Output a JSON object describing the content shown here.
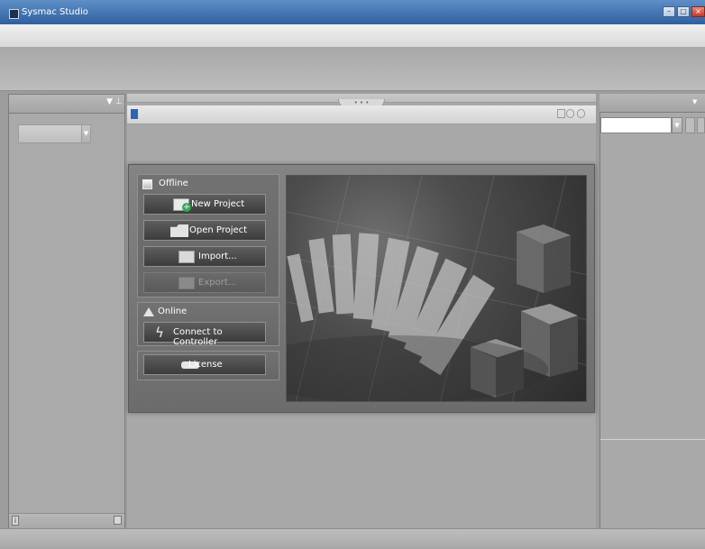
{
  "window": {
    "title": "Sysmac Studio"
  },
  "start_page": {
    "offline": {
      "title": "Offline",
      "new_project": "New Project",
      "open_project": "Open Project",
      "import": "Import...",
      "export": "Export..."
    },
    "online": {
      "title": "Online",
      "connect": "Connect to Controller"
    },
    "license": "License"
  },
  "colors": {
    "titlebar": "#3f6fa9",
    "panel_bg": "#a9a9a9",
    "button": "#4a4a4a",
    "accent_new": "#34a853"
  }
}
